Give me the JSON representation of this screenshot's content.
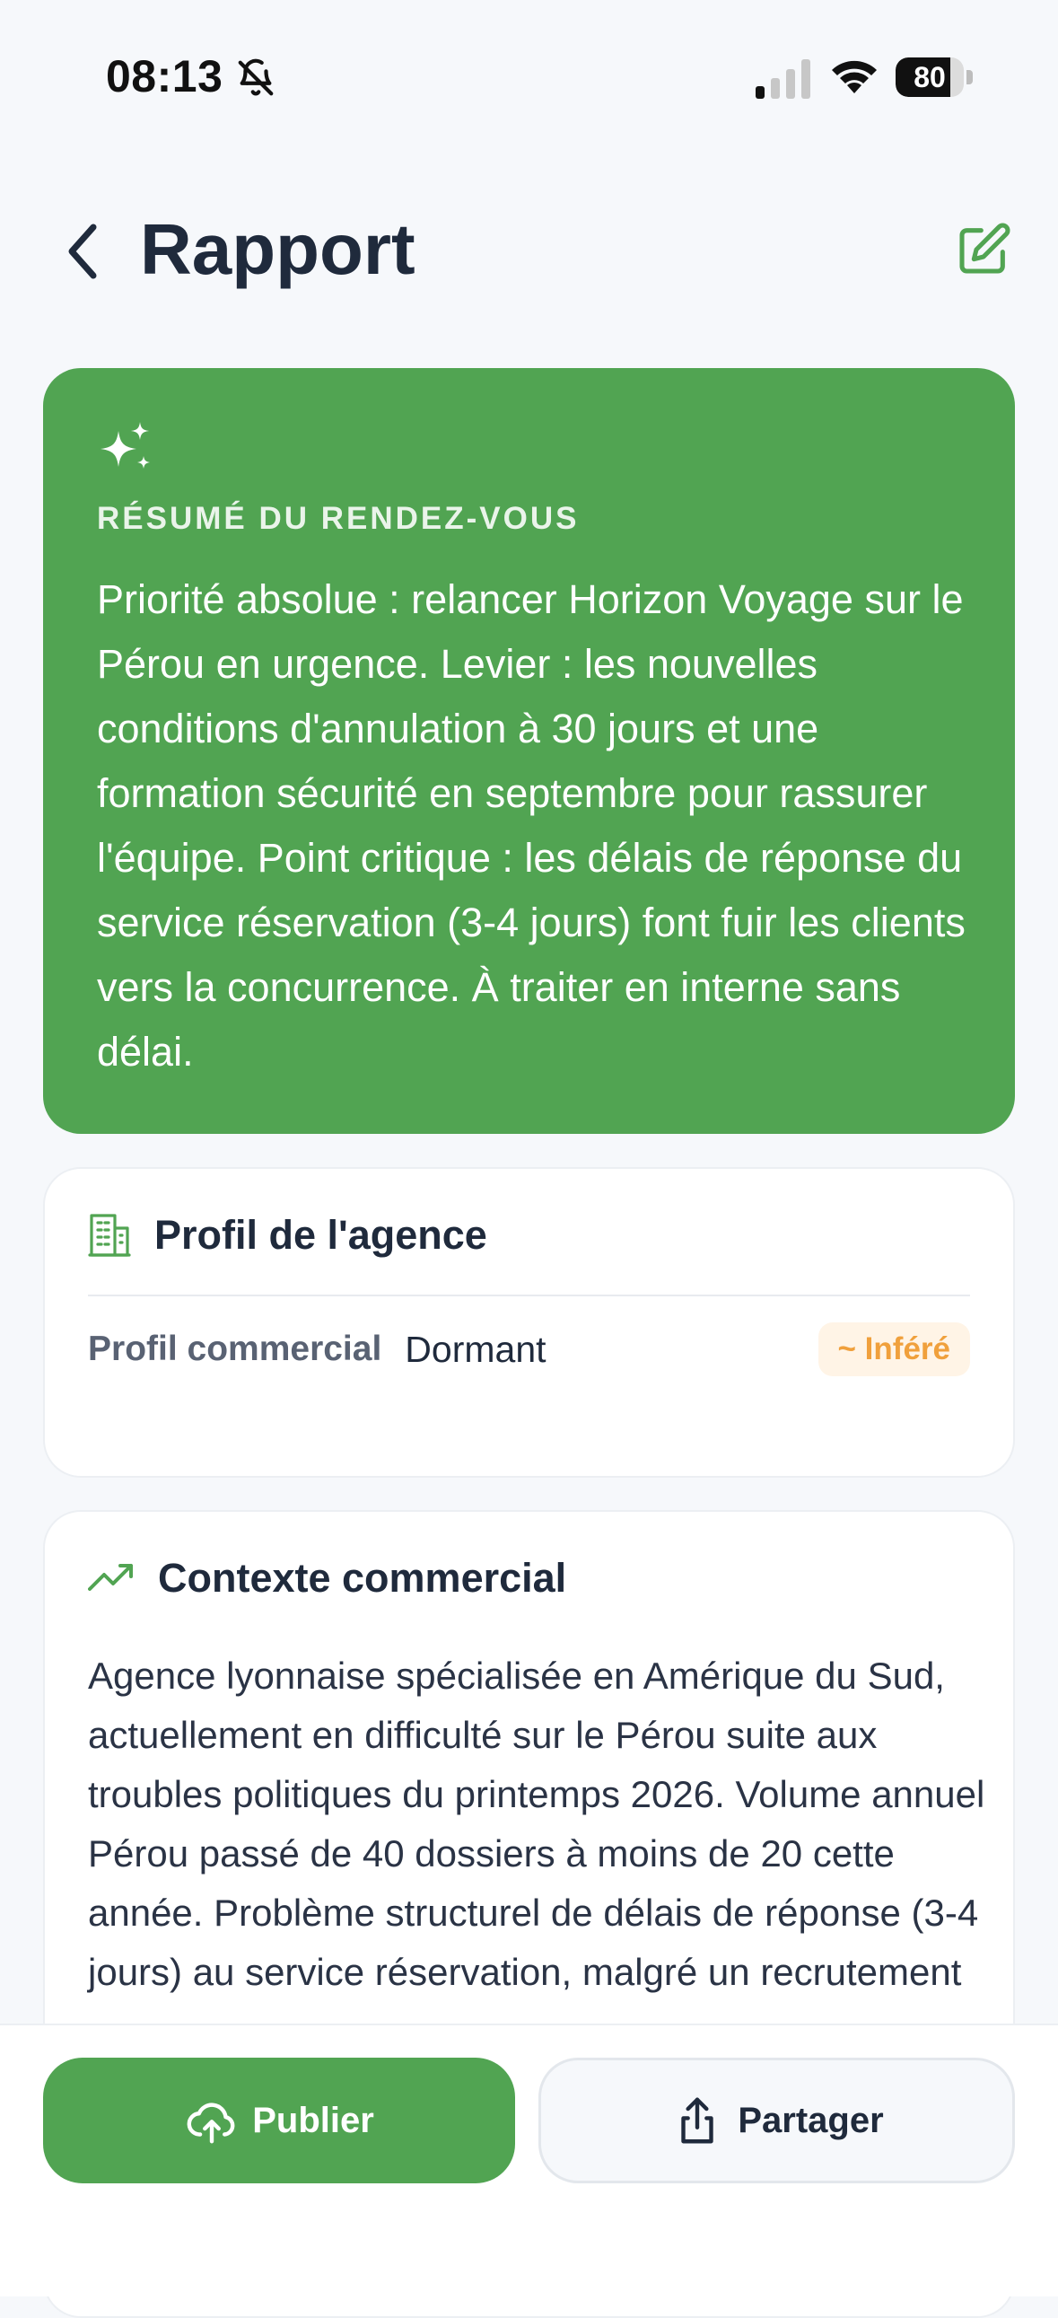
{
  "status_bar": {
    "time": "08:13",
    "battery": "80",
    "battery_level": 0.8
  },
  "header": {
    "title": "Rapport"
  },
  "summary": {
    "label": "RÉSUMÉ DU RENDEZ-VOUS",
    "text": "Priorité absolue : relancer Horizon Voyage sur le Pérou en urgence. Levier : les nouvelles conditions d'annulation à 30 jours et une formation sécurité en septembre pour rassurer l'équipe. Point critique : les délais de réponse du service réservation (3-4 jours) font fuir les clients vers la concurrence. À traiter en interne sans délai."
  },
  "profile": {
    "title": "Profil de l'agence",
    "field_label": "Profil commercial",
    "field_value": "Dormant",
    "badge": "~ Inféré"
  },
  "context": {
    "title": "Contexte commercial",
    "text": "Agence lyonnaise spécialisée en Amérique du Sud, actuellement en difficulté sur le Pérou suite aux troubles politiques du printemps 2026. Volume annuel Pérou passé de 40 dossiers à moins de 20 cette année. Problème structurel de délais de réponse (3-4 jours) au service réservation, malgré un recrutement"
  },
  "actions": {
    "publish": "Publier",
    "share": "Partager"
  },
  "colors": {
    "accent": "#51a452",
    "badge_bg": "#fff4e6",
    "badge_text": "#f0a03c"
  }
}
